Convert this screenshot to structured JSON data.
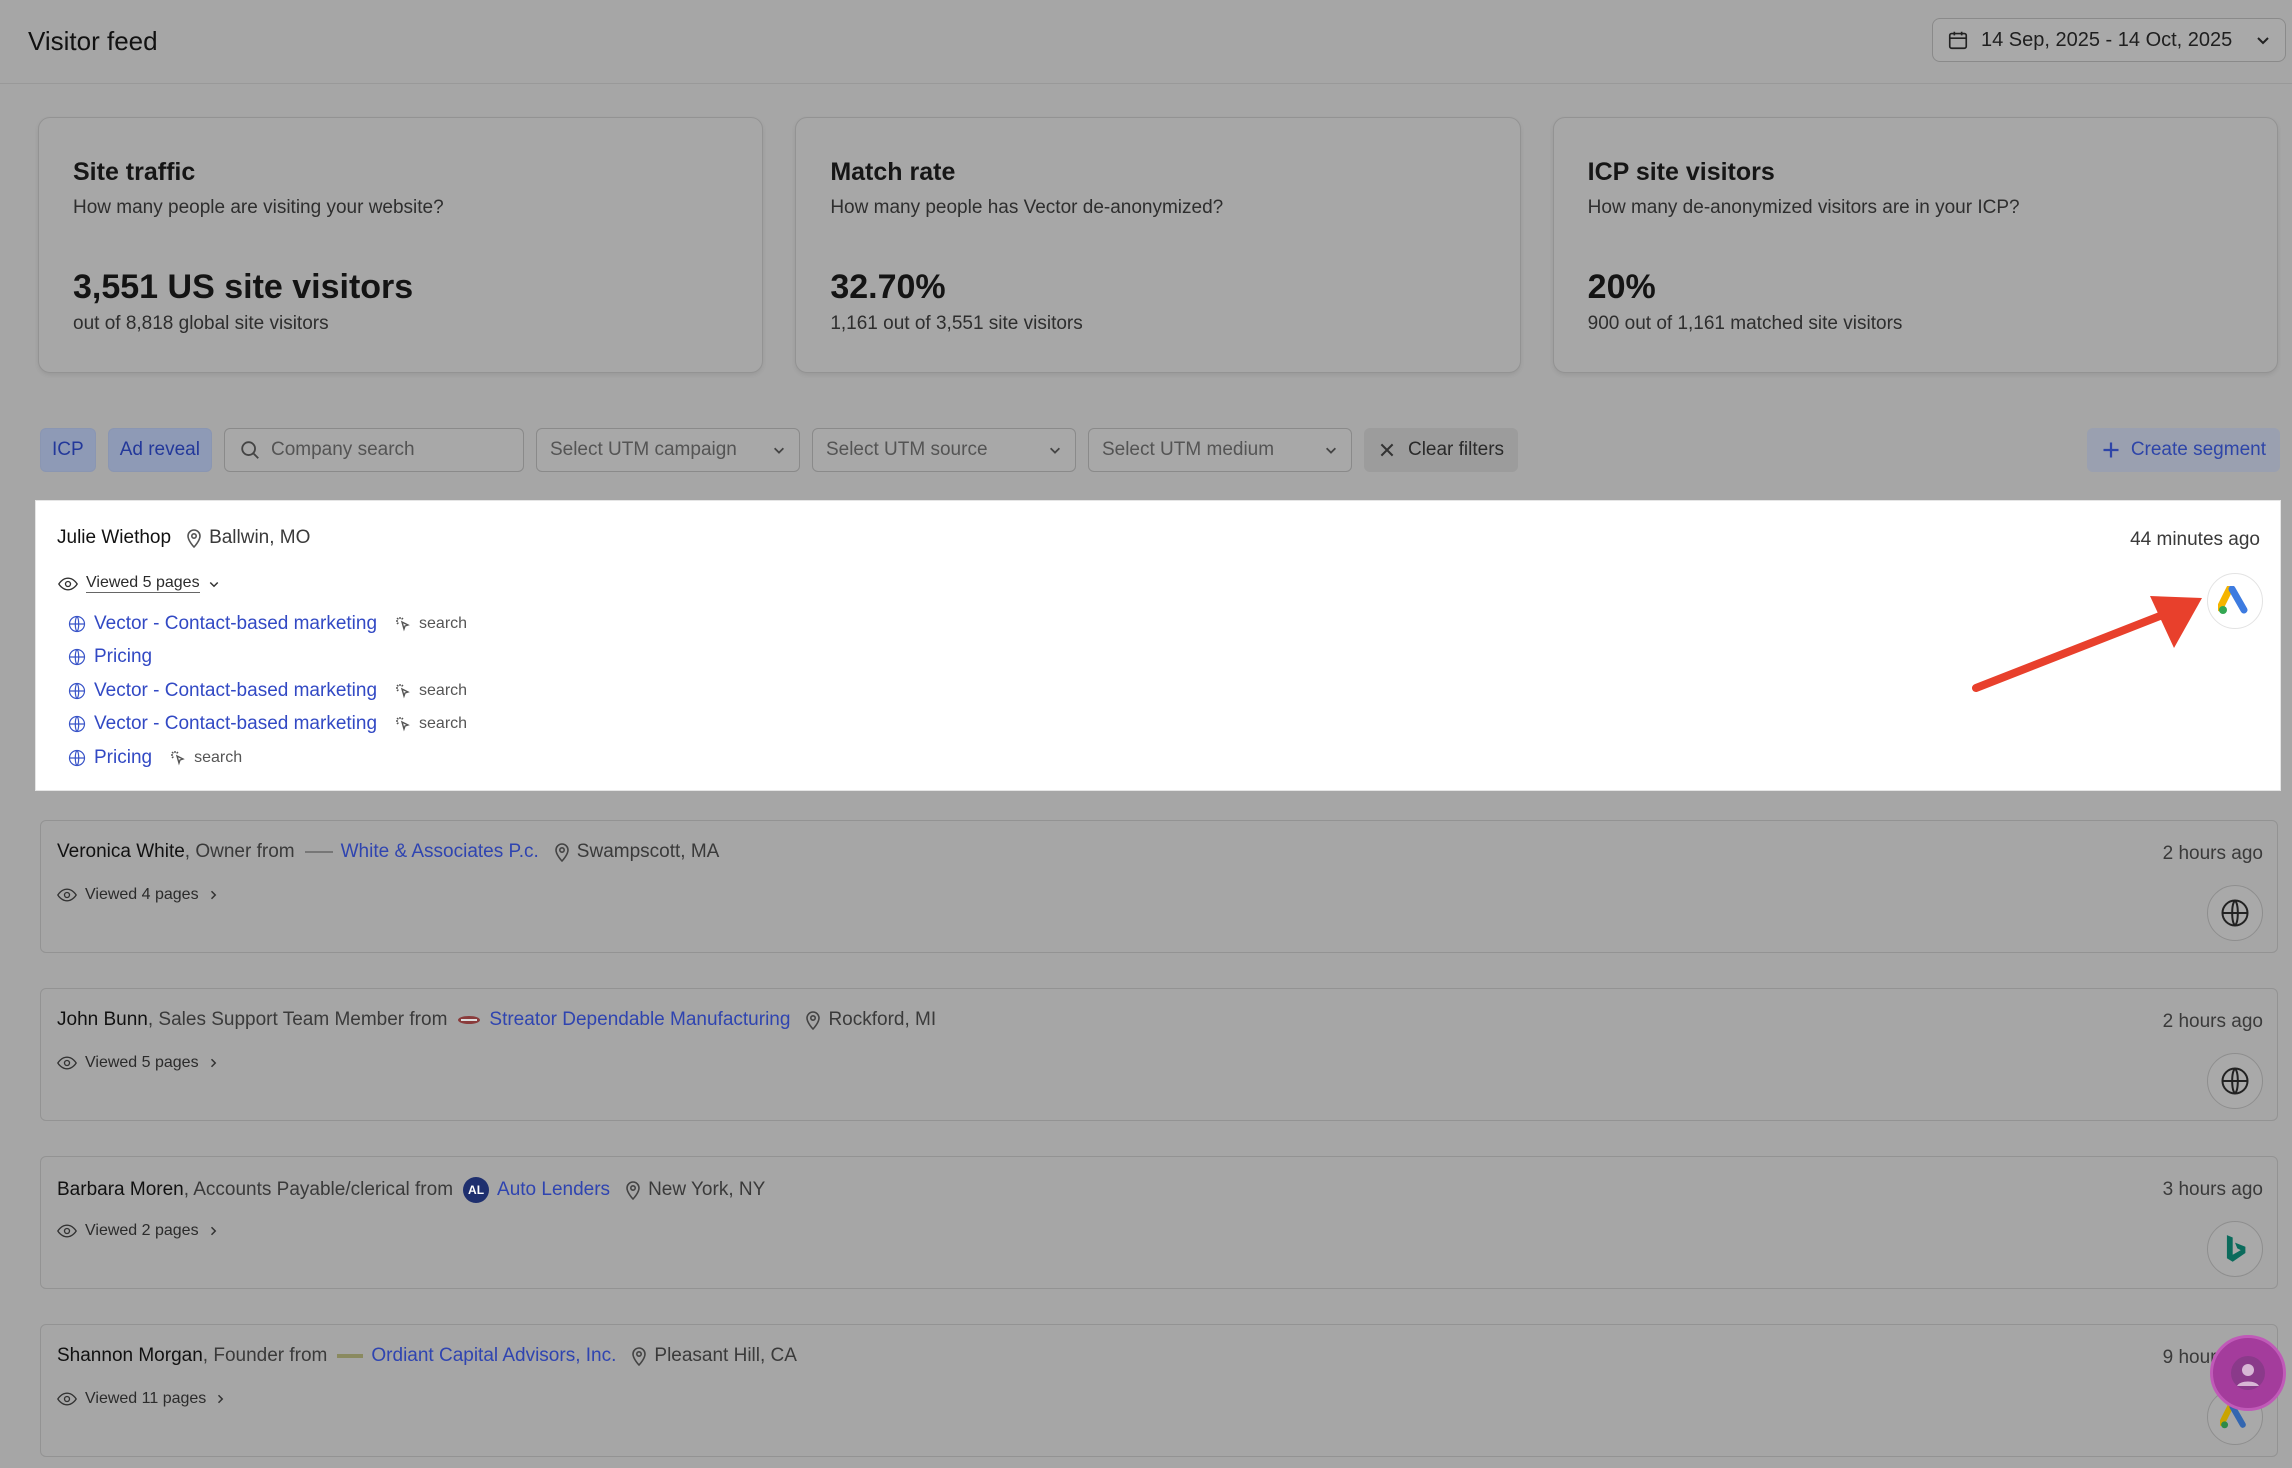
{
  "header": {
    "title": "Visitor feed",
    "date_range": "14 Sep, 2025 - 14 Oct, 2025"
  },
  "stats": [
    {
      "title": "Site traffic",
      "subtitle": "How many people are visiting your website?",
      "value": "3,551 US site visitors",
      "note": "out of 8,818 global site visitors"
    },
    {
      "title": "Match rate",
      "subtitle": "How many people has Vector de-anonymized?",
      "value": "32.70%",
      "note": "1,161 out of 3,551 site visitors"
    },
    {
      "title": "ICP site visitors",
      "subtitle": "How many de-anonymized visitors are in your ICP?",
      "value": "20%",
      "note": "900 out of 1,161 matched site visitors"
    }
  ],
  "filters": {
    "icp": "ICP",
    "ad_reveal": "Ad reveal",
    "company_search_placeholder": "Company search",
    "utm_campaign": "Select UTM campaign",
    "utm_source": "Select UTM source",
    "utm_medium": "Select UTM medium",
    "clear": "Clear filters",
    "create_segment": "Create segment"
  },
  "visitors": [
    {
      "name": "Julie Wiethop",
      "location": "Ballwin, MO",
      "time": "44 minutes ago",
      "viewed": "Viewed 5 pages",
      "source_icon": "google-ads-icon",
      "pages": [
        {
          "title": "Vector - Contact-based marketing",
          "source": "search"
        },
        {
          "title": "Pricing",
          "source": ""
        },
        {
          "title": "Vector - Contact-based marketing",
          "source": "search"
        },
        {
          "title": "Vector - Contact-based marketing",
          "source": "search"
        },
        {
          "title": "Pricing",
          "source": "search"
        }
      ]
    },
    {
      "name": "Veronica White",
      "role": ", Owner from",
      "company": "White & Associates P.c.",
      "location": "Swampscott, MA",
      "time": "2 hours ago",
      "viewed": "Viewed 4 pages",
      "source_icon": "globe-icon"
    },
    {
      "name": "John Bunn",
      "role": ", Sales Support Team Member from",
      "company": "Streator Dependable Manufacturing",
      "location": "Rockford, MI",
      "time": "2 hours ago",
      "viewed": "Viewed 5 pages",
      "source_icon": "globe-icon"
    },
    {
      "name": "Barbara Moren",
      "role": ", Accounts Payable/clerical from",
      "company": "Auto Lenders",
      "company_logo_text": "AL",
      "location": "New York, NY",
      "time": "3 hours ago",
      "viewed": "Viewed 2 pages",
      "source_icon": "bing-icon"
    },
    {
      "name": "Shannon Morgan",
      "role": ", Founder from",
      "company": "Ordiant Capital Advisors, Inc.",
      "location": "Pleasant Hill, CA",
      "time": "9 hours ago",
      "viewed": "Viewed 11 pages",
      "source_icon": "google-ads-icon"
    }
  ],
  "colors": {
    "accent_link": "#2f44b0",
    "arrow": "#e8402c",
    "overlay_bg": "#a6a6a6"
  }
}
